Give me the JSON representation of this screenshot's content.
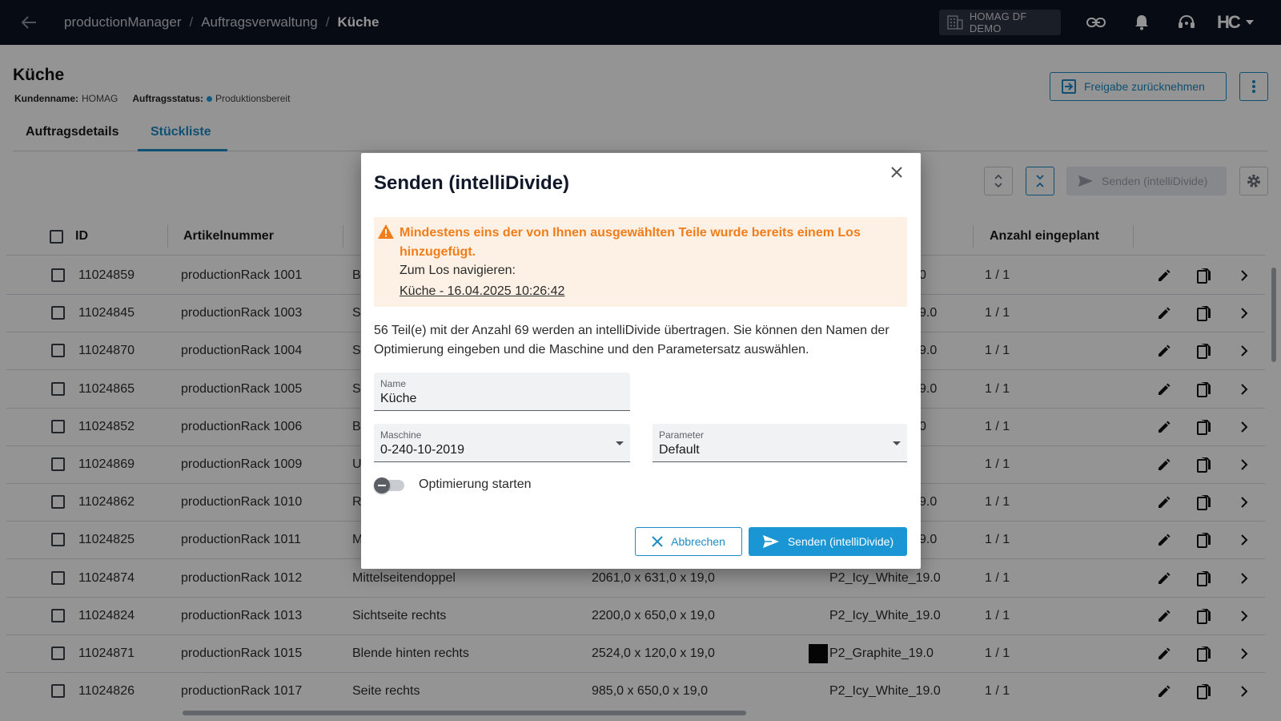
{
  "topbar": {
    "breadcrumb": [
      "productionManager",
      "Auftragsverwaltung",
      "Küche"
    ],
    "tenant": "HOMAG DF DEMO",
    "logo": "HC"
  },
  "page": {
    "title": "Küche",
    "customer_label": "Kundenname:",
    "customer_value": "HOMAG",
    "status_label": "Auftragsstatus:",
    "status_value": "Produktionsbereit",
    "freigabe_button": "Freigabe zurücknehmen",
    "tabs": [
      "Auftragsdetails",
      "Stückliste"
    ],
    "send_button": "Senden (intelliDivide)"
  },
  "table": {
    "headers": {
      "id": "ID",
      "artikel": "Artikelnummer",
      "anzahl": "Anzahl eingeplant"
    },
    "rows": [
      {
        "id": "11024859",
        "artikel": "productionRack 1001",
        "bez": "B",
        "mass": "",
        "material": "0",
        "anzahl": "1 / 1"
      },
      {
        "id": "11024845",
        "artikel": "productionRack 1003",
        "bez": "S",
        "mass": "",
        "material": "9.0",
        "anzahl": "1 / 1"
      },
      {
        "id": "11024870",
        "artikel": "productionRack 1004",
        "bez": "S",
        "mass": "",
        "material": "9.0",
        "anzahl": "1 / 1"
      },
      {
        "id": "11024865",
        "artikel": "productionRack 1005",
        "bez": "S",
        "mass": "",
        "material": "9.0",
        "anzahl": "1 / 1"
      },
      {
        "id": "11024852",
        "artikel": "productionRack 1006",
        "bez": "B",
        "mass": "",
        "material": "0",
        "anzahl": "1 / 1"
      },
      {
        "id": "11024869",
        "artikel": "productionRack 1009",
        "bez": "U",
        "mass": "",
        "material": "",
        "anzahl": "1 / 1"
      },
      {
        "id": "11024862",
        "artikel": "productionRack 1010",
        "bez": "R",
        "mass": "",
        "material": "9.0",
        "anzahl": "1 / 1"
      },
      {
        "id": "11024825",
        "artikel": "productionRack 1011",
        "bez": "M",
        "mass": "",
        "material": "9.0",
        "anzahl": "1 / 1"
      },
      {
        "id": "11024874",
        "artikel": "productionRack 1012",
        "bez": "Mittelseitendoppel",
        "mass": "2061,0 x 631,0 x 19,0",
        "material": "P2_Icy_White_19.0",
        "anzahl": "1 / 1"
      },
      {
        "id": "11024824",
        "artikel": "productionRack 1013",
        "bez": "Sichtseite rechts",
        "mass": "2200,0 x 650,0 x 19,0",
        "material": "P2_Icy_White_19.0",
        "anzahl": "1 / 1"
      },
      {
        "id": "11024871",
        "artikel": "productionRack 1015",
        "bez": "Blende hinten rechts",
        "mass": "2524,0 x 120,0 x 19,0",
        "material": "P2_Graphite_19.0",
        "anzahl": "1 / 1"
      },
      {
        "id": "11024826",
        "artikel": "productionRack 1017",
        "bez": "Seite rechts",
        "mass": "985,0 x 650,0 x 19,0",
        "material": "P2_Icy_White_19.0",
        "anzahl": "1 / 1"
      }
    ]
  },
  "modal": {
    "title": "Senden (intelliDivide)",
    "warning": "Mindestens eins der von Ihnen ausgewählten Teile wurde bereits einem Los hinzugefügt.",
    "nav_label": "Zum Los navigieren:",
    "nav_link": "Küche - 16.04.2025 10:26:42",
    "description": "56 Teil(e) mit der Anzahl 69 werden an intelliDivide übertragen. Sie können den Namen der Optimierung eingeben und die Maschine und den Parametersatz auswählen.",
    "name_label": "Name",
    "name_value": "Küche",
    "machine_label": "Maschine",
    "machine_value": "0-240-10-2019",
    "param_label": "Parameter",
    "param_value": "Default",
    "toggle_label": "Optimierung starten",
    "toggle_on": false,
    "cancel": "Abbrechen",
    "send": "Senden (intelliDivide)"
  },
  "colors": {
    "accent": "#1d8bc6",
    "warning": "#f07d1a",
    "topbar": "#0b1424"
  }
}
